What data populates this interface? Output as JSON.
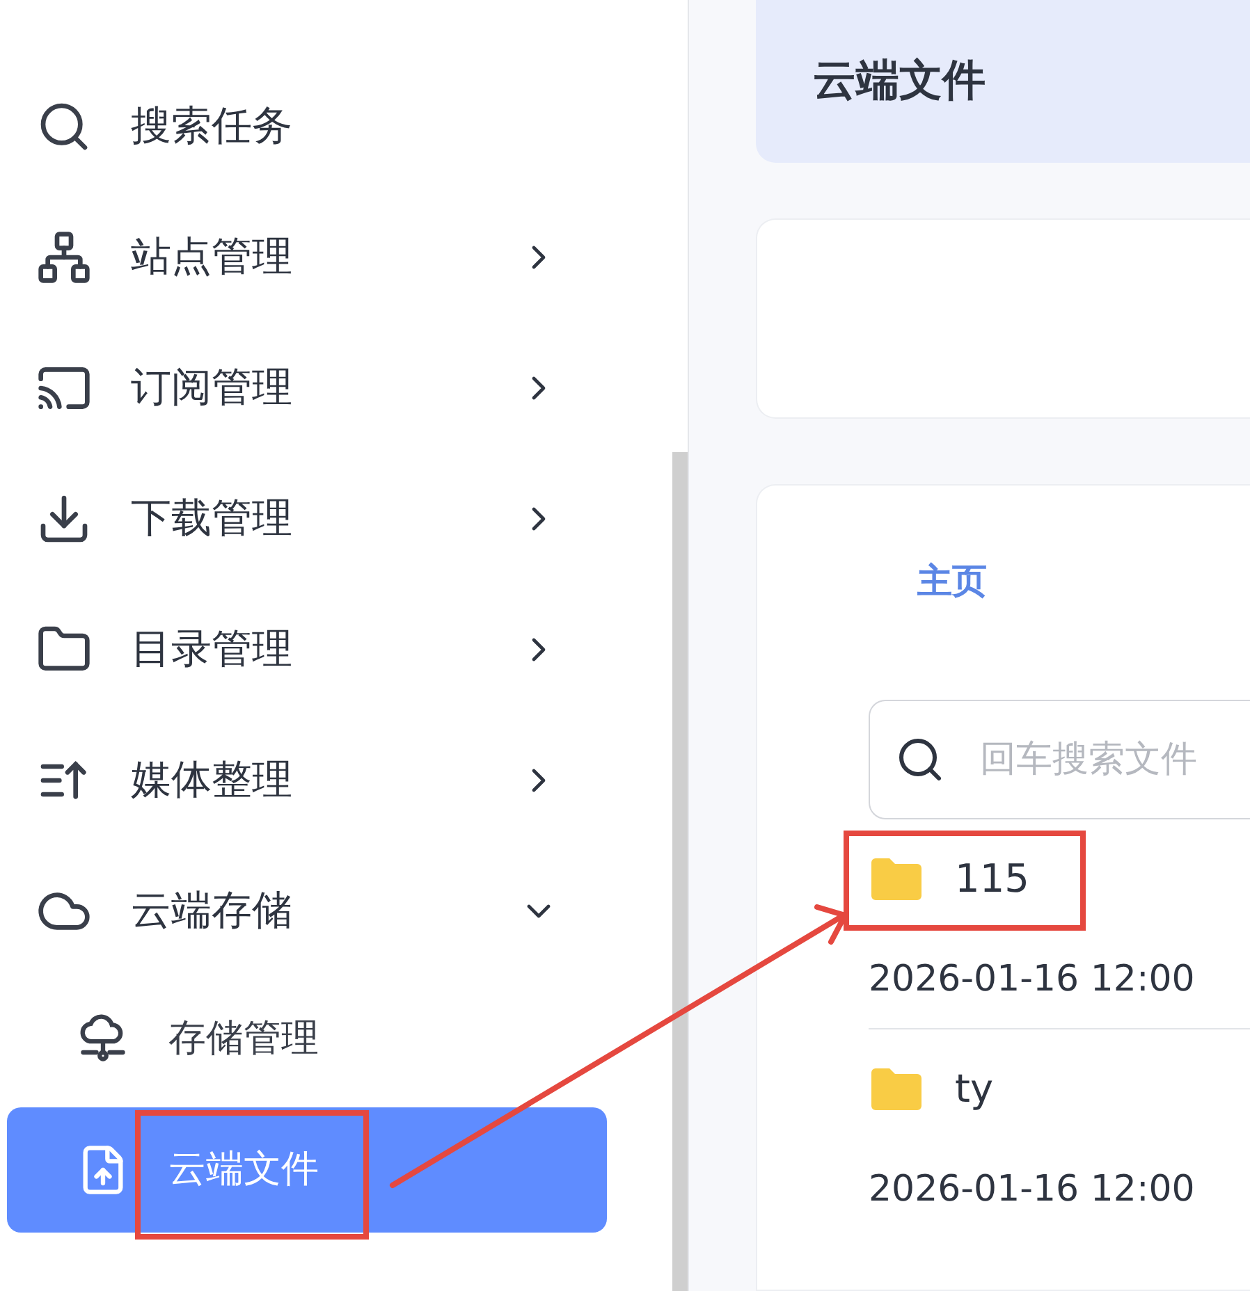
{
  "sidebar": {
    "items": [
      {
        "label": "搜索任务"
      },
      {
        "label": "站点管理",
        "expanded": false
      },
      {
        "label": "订阅管理",
        "expanded": false
      },
      {
        "label": "下载管理",
        "expanded": false
      },
      {
        "label": "目录管理",
        "expanded": false
      },
      {
        "label": "媒体整理",
        "expanded": false
      },
      {
        "label": "云端存储",
        "expanded": true,
        "children": [
          {
            "label": "存储管理",
            "selected": false
          },
          {
            "label": "云端文件",
            "selected": true
          }
        ]
      }
    ]
  },
  "header": {
    "title": "云端文件"
  },
  "breadcrumb": "主页",
  "search": {
    "placeholder": "回车搜索文件"
  },
  "files": [
    {
      "name": "115",
      "modified": "2026-01-16 12:00"
    },
    {
      "name": "ty",
      "modified": "2026-01-16 12:00"
    }
  ]
}
